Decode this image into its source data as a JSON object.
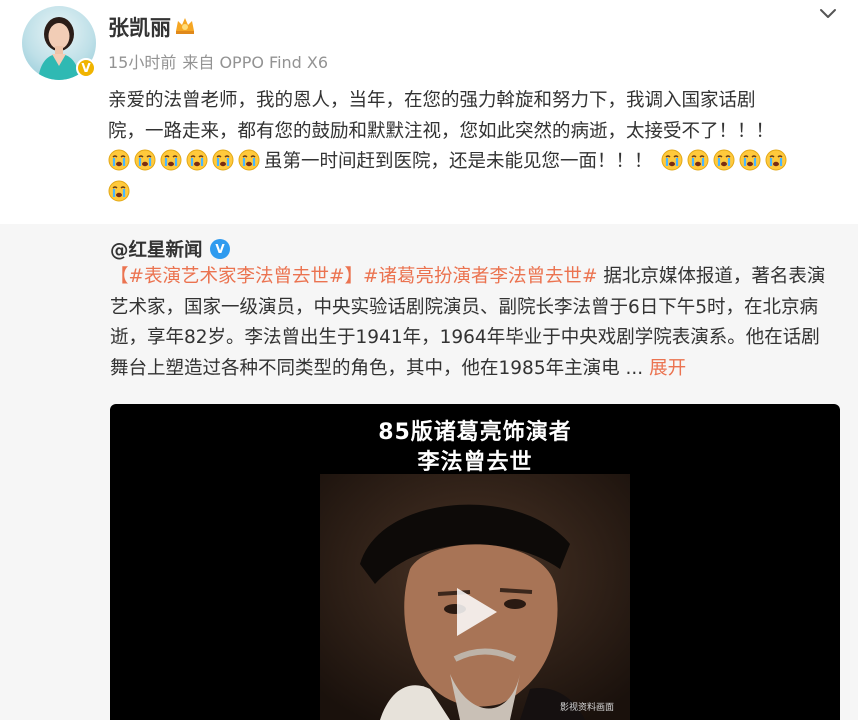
{
  "post": {
    "author": "张凯丽",
    "meta": {
      "time": "15小时前",
      "source": "来自 OPPO Find X6"
    },
    "text_line1": "亲爱的法曾老师，我的恩人，当年，在您的强力斡旋和努力下，我调入国家话剧",
    "text_line2": "院，一路走来，都有您的鼓励和默默注视，您如此突然的病逝，太接受不了！！！",
    "text_line3": "虽第一时间赶到医院，还是未能见您一面！！！",
    "emoji_name": "crying-emoji",
    "emoji_count_before": 6,
    "emoji_count_after": 5,
    "emoji_count_last_line": 1
  },
  "repost": {
    "author": "@红星新闻",
    "topic1": "【#表演艺术家李法曾去世#】",
    "topic2": "#诸葛亮扮演者李法曾去世#",
    "text_line1_rest": "据北京媒体报道，著名表演",
    "text_line2": "艺术家，国家一级演员，中央实验话剧院演员、副院长李法曾于6日下午5时，在北京病",
    "text_line3": "逝，享年82岁。李法曾出生于1941年，1964年毕业于中央戏剧学院表演系。他在话剧",
    "text_line4": "舞台上塑造过各种不同类型的角色，其中，他在1985年主演电",
    "ellipsis": "...",
    "expand_label": "展开",
    "video": {
      "title_line1": "85版诸葛亮饰演者",
      "title_line2": "李法曾去世",
      "caption": "影视资料画面"
    }
  },
  "colors": {
    "topic": "#eb7350",
    "text": "#333333",
    "meta": "#939393",
    "repost_bg": "#f6f6f6",
    "verified_blue": "#2f9bef",
    "verified_gold": "#f0b400"
  }
}
